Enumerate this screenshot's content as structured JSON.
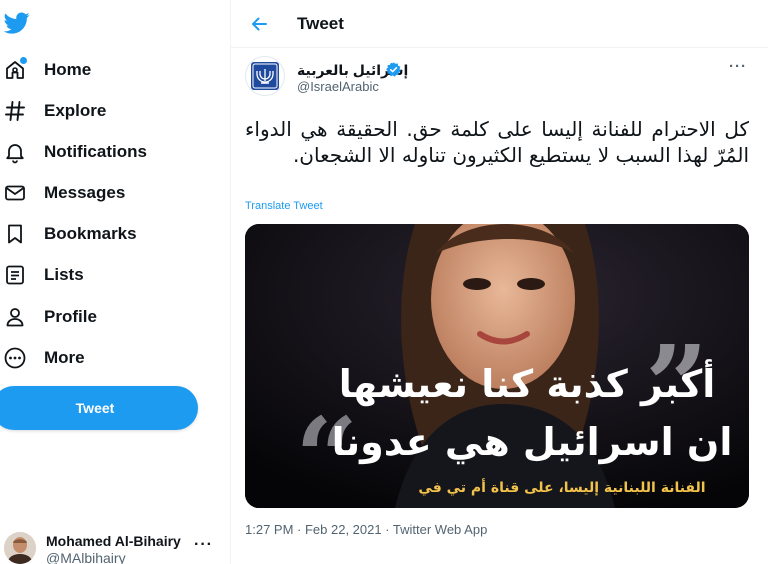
{
  "sidebar": {
    "logo": "twitter-bird-icon",
    "items": [
      {
        "label": "Home",
        "icon": "home-icon"
      },
      {
        "label": "Explore",
        "icon": "hashtag-icon"
      },
      {
        "label": "Notifications",
        "icon": "bell-icon"
      },
      {
        "label": "Messages",
        "icon": "envelope-icon"
      },
      {
        "label": "Bookmarks",
        "icon": "bookmark-icon"
      },
      {
        "label": "Lists",
        "icon": "list-icon"
      },
      {
        "label": "Profile",
        "icon": "person-icon"
      },
      {
        "label": "More",
        "icon": "more-circle-icon"
      }
    ],
    "tweet_button": "Tweet",
    "account": {
      "name": "Mohamed Al-Bihairy",
      "handle": "@MAlbihairy",
      "more": "···"
    }
  },
  "header": {
    "title": "Tweet"
  },
  "tweet": {
    "author_name": "إسرائيل بالعربية",
    "author_handle": "@IsraelArabic",
    "more": "···",
    "text": "كل الاحترام للفنانة إليسا على كلمة حق. الحقيقة هي الدواء المُرّ لهذا السبب لا يستطيع الكثيرون تناوله الا الشجعان.",
    "translate": "Translate Tweet",
    "media": {
      "line1": "أكبر كذبة كنا نعيشها",
      "line2": "ان اسرائيل هي عدونا",
      "caption": "الفنانة اللبنانية إليسا، على قناة أم تي في"
    },
    "meta": "1:27 PM · Feb 22, 2021 · Twitter Web App"
  },
  "colors": {
    "accent": "#1d9bf0",
    "text": "#0f1419",
    "muted": "#536471",
    "caption": "#f2c24a"
  }
}
